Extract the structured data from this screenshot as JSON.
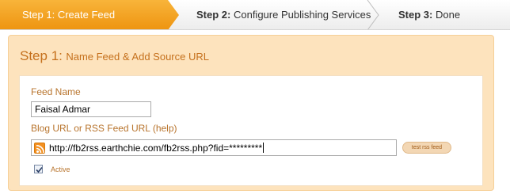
{
  "wizard": {
    "steps": [
      {
        "prefix": "Step 1:",
        "label": "Create Feed",
        "state": "active"
      },
      {
        "prefix": "Step 2:",
        "label": "Configure Publishing Services",
        "state": "pending"
      },
      {
        "prefix": "Step 3:",
        "label": "Done",
        "state": "pending"
      }
    ]
  },
  "section": {
    "title_prefix": "Step 1:",
    "title": "Name Feed & Add Source URL"
  },
  "form": {
    "feed_name_label": "Feed Name",
    "feed_name_value": "Faisal Admar",
    "url_label": "Blog URL or RSS Feed URL (help)",
    "url_value": "http://fb2rss.earthchie.com/fb2rss.php?fid=*********",
    "url_icon": "rss-icon",
    "test_button_label": "test rss feed",
    "active_label": "Active",
    "active_checked": true
  },
  "colors": {
    "active_step": "#f5a623",
    "accent_text": "#c5701c",
    "panel_bg": "#fde3bd"
  }
}
